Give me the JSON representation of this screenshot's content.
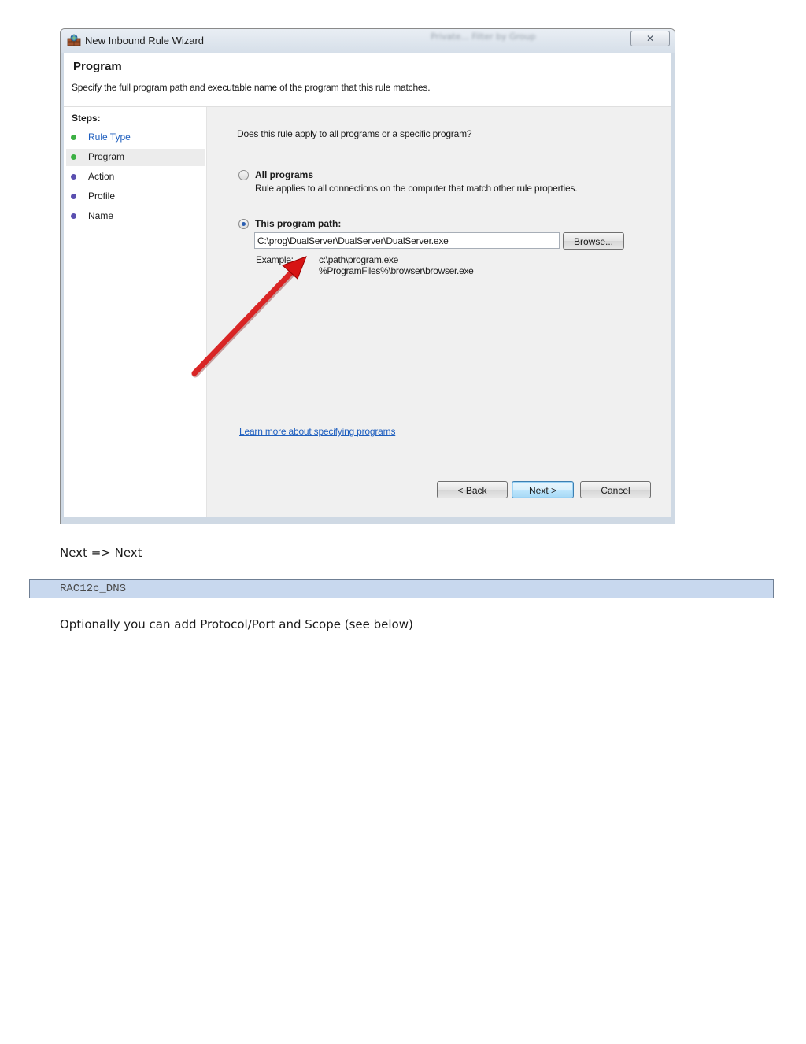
{
  "window": {
    "title": "New Inbound Rule Wizard",
    "blurred_background_text": "Private...   Filter by Group",
    "close_glyph": "✕"
  },
  "header": {
    "title": "Program",
    "description": "Specify the full program path and executable name of the program that this rule matches."
  },
  "steps": {
    "label": "Steps:",
    "items": [
      {
        "label": "Rule Type",
        "color": "#3cb043",
        "state": "done"
      },
      {
        "label": "Program",
        "color": "#3cb043",
        "state": "current"
      },
      {
        "label": "Action",
        "color": "#5a4fb0",
        "state": "pending"
      },
      {
        "label": "Profile",
        "color": "#5a4fb0",
        "state": "pending"
      },
      {
        "label": "Name",
        "color": "#5a4fb0",
        "state": "pending"
      }
    ]
  },
  "content": {
    "question": "Does this rule apply to all programs or a specific program?",
    "option_all": {
      "label": "All programs",
      "description": "Rule applies to all connections on the computer that match other rule properties.",
      "selected": false
    },
    "option_path": {
      "label": "This program path:",
      "selected": true,
      "value": "C:\\prog\\DualServer\\DualServer\\DualServer.exe"
    },
    "browse_label": "Browse...",
    "example_label": "Example:",
    "example_lines": [
      "c:\\path\\program.exe",
      "%ProgramFiles%\\browser\\browser.exe"
    ],
    "learn_more": "Learn more about specifying programs"
  },
  "buttons": {
    "back": "< Back",
    "next": "Next >",
    "cancel": "Cancel"
  },
  "annotation": {
    "arrow_color": "#e01b1b"
  },
  "document": {
    "line1": "Next => Next",
    "code": "RAC12c_DNS",
    "line2": "Optionally you can add Protocol/Port and Scope (see below)"
  }
}
